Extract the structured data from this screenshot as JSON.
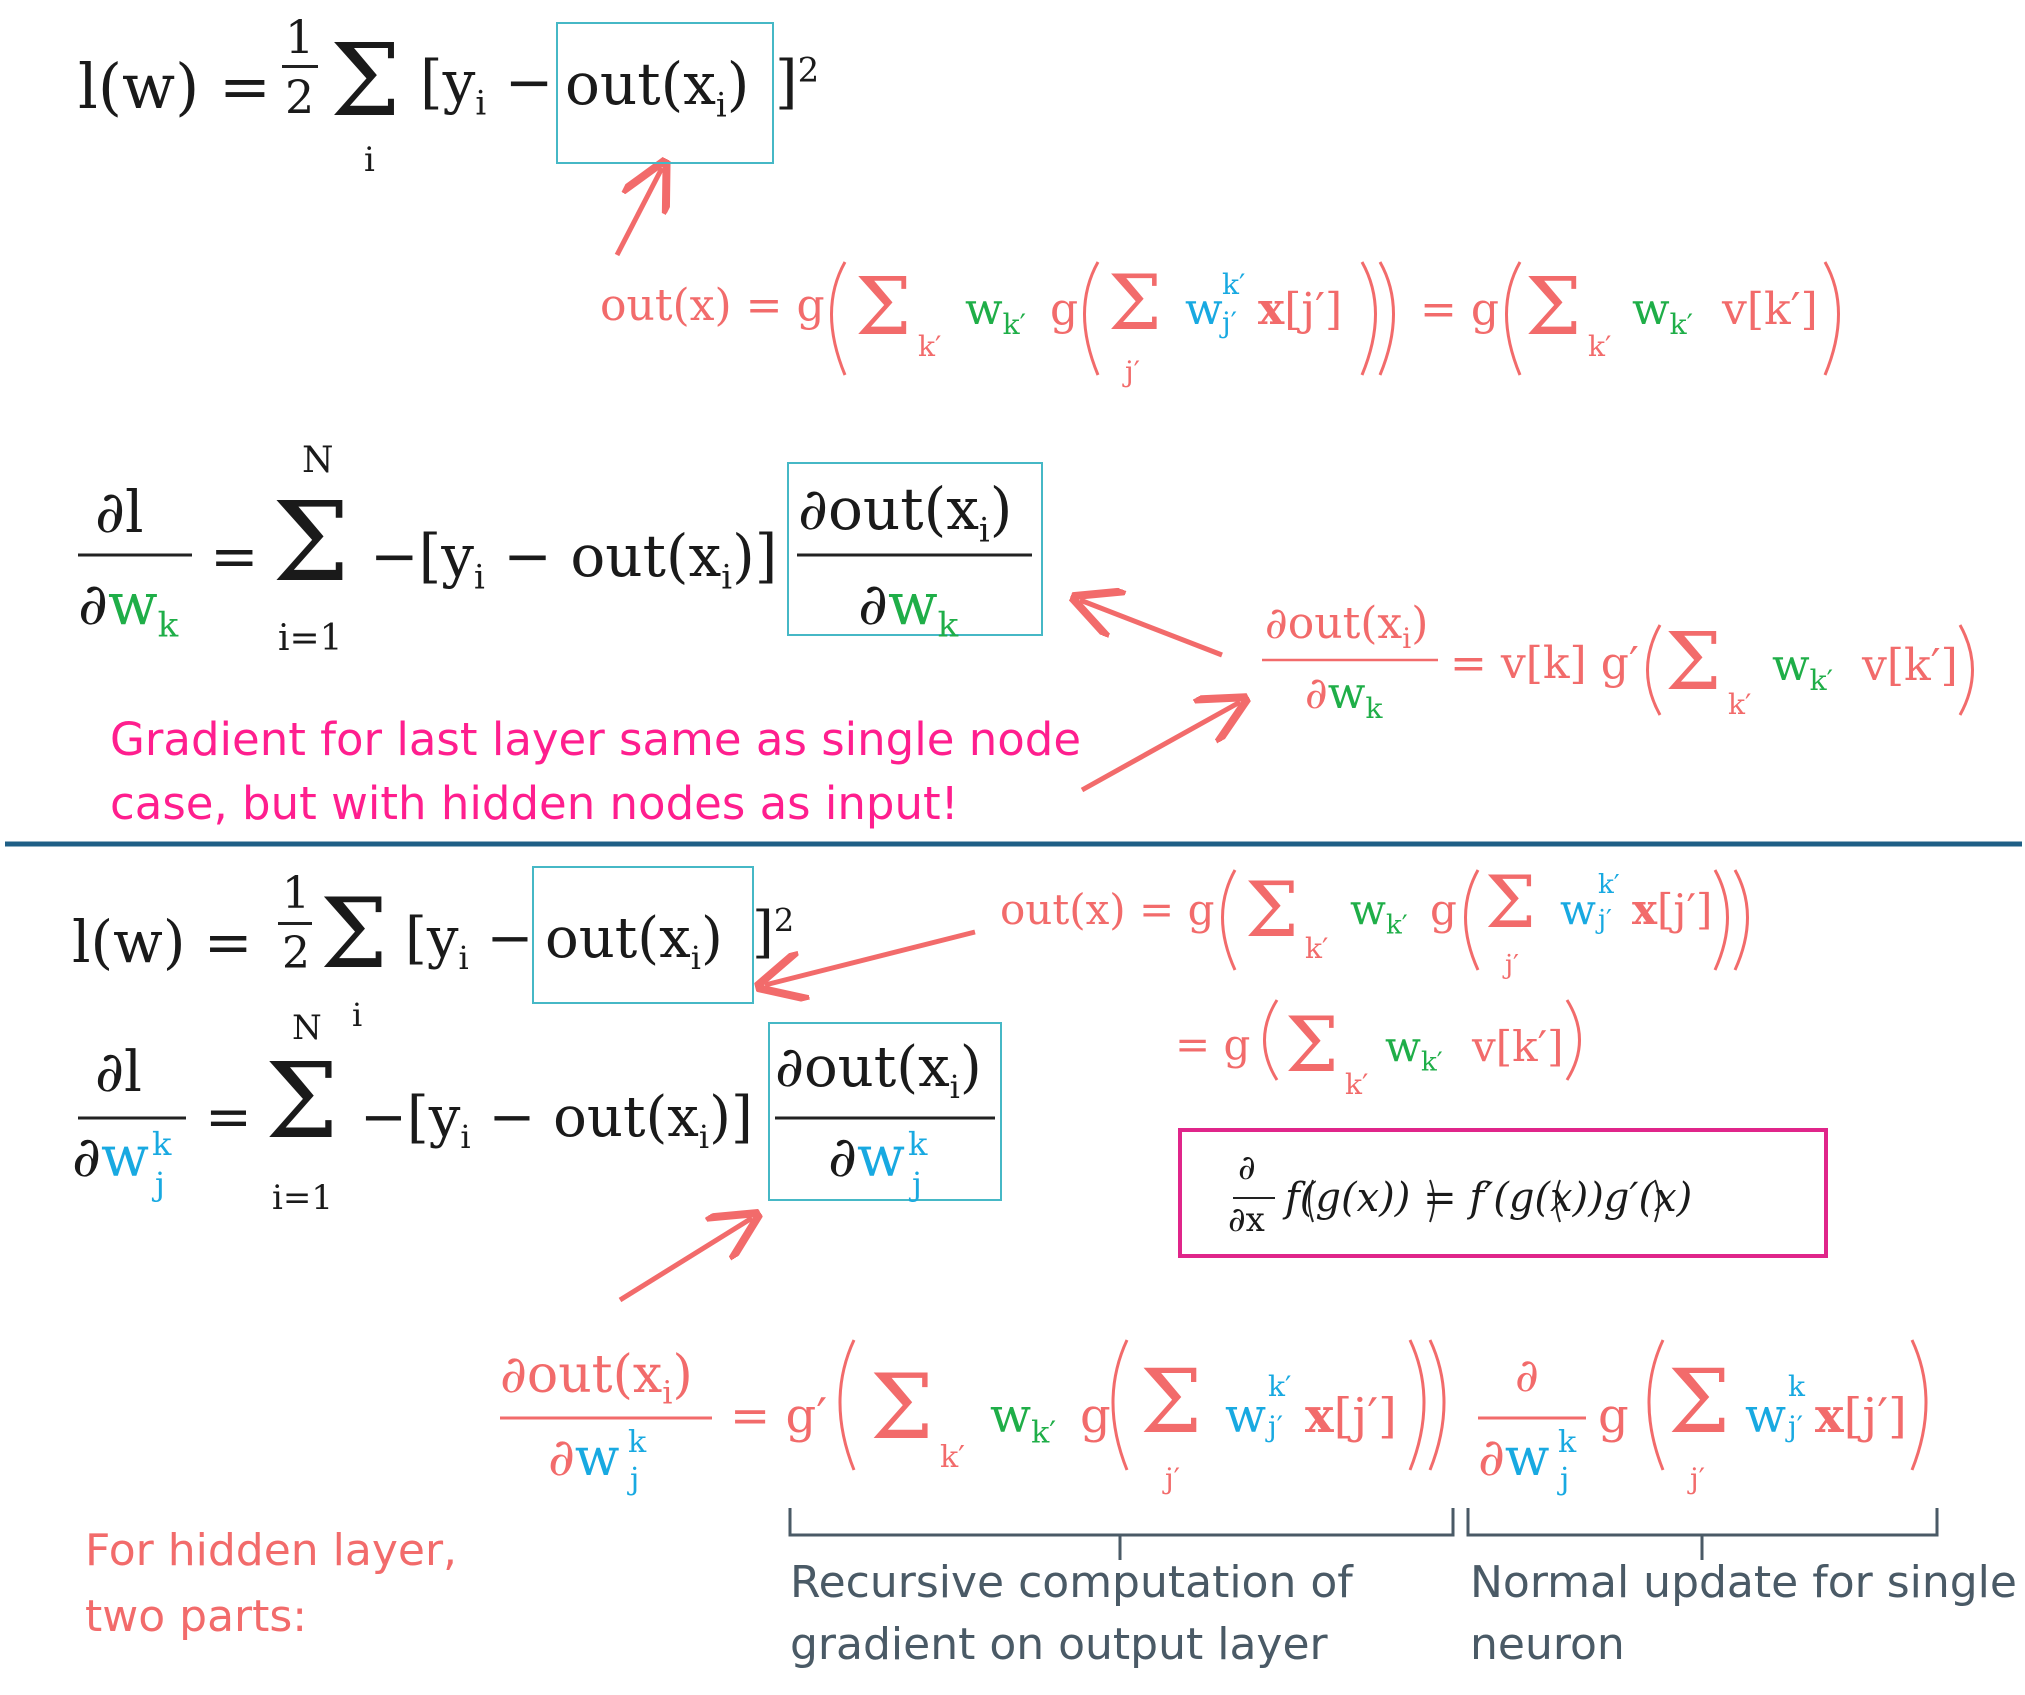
{
  "colors": {
    "coral": "#f26b6b",
    "green": "#1fae48",
    "blue": "#18a9e1",
    "pink": "#ff1e8e",
    "gray_text": "#4a5a66",
    "divider": "#1f5f86",
    "box_teal": "#46b8c6",
    "box_pink": "#e0258a"
  },
  "top": {
    "loss": {
      "lhs": "l(w) =",
      "half": "1/2",
      "sum": "Σ",
      "sum_index": "i",
      "bracket_open": "[y",
      "y_sub": "i",
      "minus": "−",
      "boxed": "out(x",
      "boxed_sub": "i",
      "boxed_close": ")",
      "bracket_close": "]",
      "power": "2"
    },
    "out_expr": {
      "lhs": "out(x) = g",
      "w_outer": "w",
      "w_outer_sub": "k′",
      "g2": "g",
      "w_inner": "w",
      "w_inner_sup": "k′",
      "w_inner_sub": "j′",
      "x_term": "x[j′]",
      "sum_sub_k": "k′",
      "sum_sub_j": "j′",
      "eq2": "= g",
      "w_outer2": "w",
      "w_outer2_sub": "k′",
      "v_term": "v[k′]"
    },
    "grad": {
      "num": "∂l",
      "den_d": "∂",
      "den_w": "w",
      "den_sub": "k",
      "eq": "=",
      "sum_top": "N",
      "sum_bottom": "i=1",
      "term": "−[y",
      "term_sub": "i",
      "term_mid": " − out(x",
      "term_sub2": "i",
      "term_end": ")]",
      "box_num": "∂out(x",
      "box_num_sub": "i",
      "box_num_end": ")",
      "box_den_d": "∂",
      "box_den_w": "w",
      "box_den_sub": "k"
    },
    "deriv_expr": {
      "num": "∂out(x",
      "num_sub": "i",
      "num_end": ")",
      "den_d": "∂",
      "den_w": "w",
      "den_sub": "k",
      "rhs": "= v[k] g′",
      "w": "w",
      "w_sub": "k′",
      "v_term": "v[k′]",
      "sum_sub": "k′"
    },
    "note": "Gradient for last layer same as single node case, but with hidden nodes as input!",
    "note_line1": "Gradient for last layer same as single node",
    "note_line2": "case, but with hidden nodes as input!"
  },
  "bottom": {
    "loss": {
      "lhs": "l(w) =",
      "half": "1/2",
      "sum": "Σ",
      "sum_index": "i",
      "bracket_open": "[y",
      "y_sub": "i",
      "minus": "−",
      "boxed": "out(x",
      "boxed_sub": "i",
      "boxed_close": ")",
      "bracket_close": "]",
      "power": "2"
    },
    "out_expr_line1": {
      "lhs": "out(x) = g",
      "w_outer": "w",
      "w_outer_sub": "k′",
      "g2": "g",
      "w_inner": "w",
      "w_inner_sup": "k′",
      "w_inner_sub": "j′",
      "x_term": "x[j′]"
    },
    "out_expr_line2": {
      "lhs": "= g",
      "w": "w",
      "w_sub": "k′",
      "v_term": "v[k′]"
    },
    "grad": {
      "num": "∂l",
      "den_d": "∂",
      "den_w": "w",
      "den_sup": "k",
      "den_sub": "j",
      "eq": "=",
      "sum_top": "N",
      "sum_bottom": "i=1",
      "term": "−[y",
      "term_sub": "i",
      "term_mid": " − out(x",
      "term_sub2": "i",
      "term_end": ")]",
      "box_num": "∂out(x",
      "box_num_sub": "i",
      "box_num_end": ")",
      "box_den_d": "∂",
      "box_den_w": "w",
      "box_den_sup": "k",
      "box_den_sub": "j"
    },
    "chain_rule": {
      "d": "∂",
      "dx": "∂x",
      "f_of_g": "f(g(x)) = f′(g(x))g′(x)"
    },
    "hidden_expr": {
      "num": "∂out(x",
      "num_sub": "i",
      "num_end": ")",
      "den_d": "∂",
      "den_w": "w",
      "den_sup": "k",
      "den_sub": "j",
      "rhs": "= g′",
      "w": "w",
      "w_sub": "k′",
      "g2": "g",
      "w_inner": "w",
      "w_inner_sup": "k′",
      "w_inner_sub": "j′",
      "x_term": "x[j′]",
      "d2_num": "∂",
      "d2_den_d": "∂",
      "d2_den_w": "w",
      "d2_den_sup": "k",
      "d2_den_sub": "j",
      "g3": "g",
      "w3": "w",
      "w3_sup": "k",
      "w3_sub": "j′",
      "x3": "x[j′]"
    },
    "hidden_note_line1": "For hidden layer,",
    "hidden_note_line2": "two parts:",
    "brace_left_line1": "Recursive computation of",
    "brace_left_line2": "gradient on output layer",
    "brace_right_line1": "Normal update for single",
    "brace_right_line2": "neuron"
  }
}
